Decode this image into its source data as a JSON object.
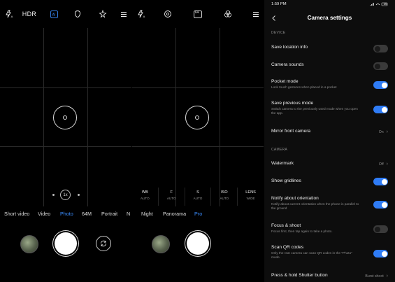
{
  "camera_photo": {
    "top_icons": [
      "flash-auto-icon",
      "hdr-icon",
      "ai-icon",
      "beauty-icon",
      "filter-icon",
      "menu-icon"
    ],
    "hdr_label": "HDR",
    "modes": [
      "Short video",
      "Video",
      "Photo",
      "64M",
      "Portrait",
      "N"
    ],
    "active_mode": "Photo",
    "zoom_label": "1x"
  },
  "camera_pro": {
    "top_icons": [
      "flash-auto-icon",
      "lens-icon",
      "64mp-icon",
      "filter-icon",
      "menu-icon"
    ],
    "badge": "64",
    "pro_controls": [
      {
        "label": "WB",
        "value": "AUTO"
      },
      {
        "label": "F",
        "value": "AUTO"
      },
      {
        "label": "S",
        "value": "AUTO"
      },
      {
        "label": "ISO",
        "value": "AUTO"
      },
      {
        "label": "LENS",
        "value": "WIDE"
      }
    ],
    "modes": [
      "Night",
      "Panorama",
      "Pro"
    ],
    "active_mode": "Pro"
  },
  "settings": {
    "status_time": "1:59 PM",
    "status_right": "56",
    "title": "Camera settings",
    "sections": {
      "device": "DEVICE",
      "camera": "CAMERA"
    },
    "items": [
      {
        "label": "Save location info",
        "desc": "",
        "type": "toggle",
        "on": false
      },
      {
        "label": "Camera sounds",
        "desc": "",
        "type": "toggle",
        "on": false
      },
      {
        "label": "Pocket mode",
        "desc": "Lock touch gestures when placed in a pocket",
        "type": "toggle",
        "on": true
      },
      {
        "label": "Save previous mode",
        "desc": "Switch camera to the previously used mode when you open the app.",
        "type": "toggle",
        "on": true
      },
      {
        "label": "Mirror front camera",
        "desc": "",
        "type": "value",
        "value": "On"
      },
      {
        "label": "Watermark",
        "desc": "",
        "type": "value",
        "value": "Off"
      },
      {
        "label": "Show gridlines",
        "desc": "",
        "type": "toggle",
        "on": true
      },
      {
        "label": "Notify about orientation",
        "desc": "Notify about current orientation when the phone is parallel to the ground",
        "type": "toggle",
        "on": true
      },
      {
        "label": "Focus & shoot",
        "desc": "Focus first, then tap again to take a photo.",
        "type": "toggle",
        "on": false
      },
      {
        "label": "Scan QR codes",
        "desc": "Only the rear camera can scan QR codes in the \"Photo\" mode.",
        "type": "toggle",
        "on": true
      },
      {
        "label": "Press & hold Shutter button",
        "desc": "",
        "type": "value",
        "value": "Burst shoot"
      }
    ]
  },
  "colors": {
    "accent": "#3a8dff",
    "toggle_on": "#2f7cf6",
    "toggle_off": "#3a3a3a",
    "background": "#000000"
  }
}
